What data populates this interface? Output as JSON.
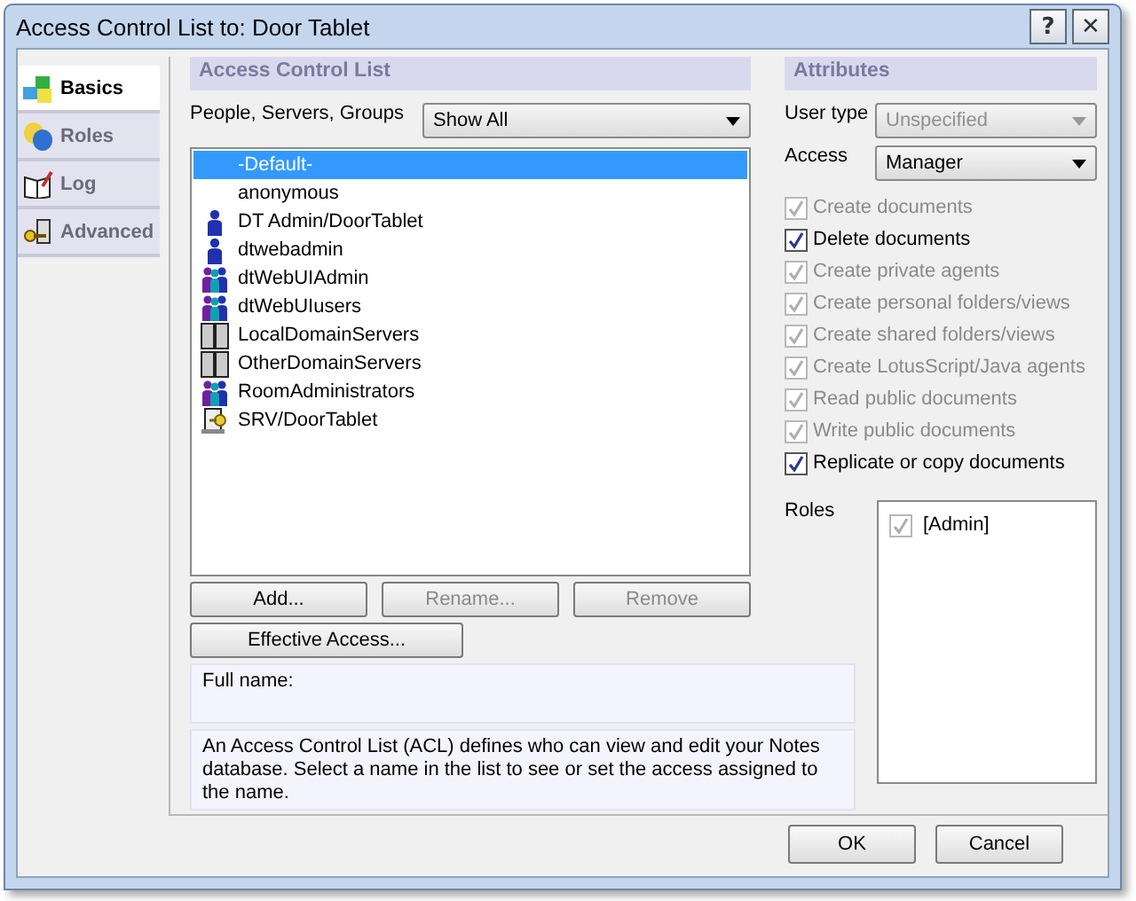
{
  "window": {
    "title": "Access Control List to: Door Tablet",
    "help_button": "?",
    "close_button": "✕"
  },
  "tabs": [
    {
      "label": "Basics",
      "selected": true
    },
    {
      "label": "Roles",
      "selected": false
    },
    {
      "label": "Log",
      "selected": false
    },
    {
      "label": "Advanced",
      "selected": false
    }
  ],
  "acl": {
    "heading": "Access Control List",
    "filter_label": "People, Servers, Groups",
    "filter_value": "Show All",
    "entries": [
      {
        "name": "-Default-",
        "kind": "none",
        "selected": true
      },
      {
        "name": "anonymous",
        "kind": "none",
        "selected": false
      },
      {
        "name": "DT Admin/DoorTablet",
        "kind": "person",
        "selected": false
      },
      {
        "name": "dtwebadmin",
        "kind": "person",
        "selected": false
      },
      {
        "name": "dtWebUIAdmin",
        "kind": "group",
        "selected": false
      },
      {
        "name": "dtWebUIusers",
        "kind": "group",
        "selected": false
      },
      {
        "name": "LocalDomainServers",
        "kind": "servers",
        "selected": false
      },
      {
        "name": "OtherDomainServers",
        "kind": "servers",
        "selected": false
      },
      {
        "name": "RoomAdministrators",
        "kind": "group",
        "selected": false
      },
      {
        "name": "SRV/DoorTablet",
        "kind": "server",
        "selected": false
      }
    ],
    "buttons": [
      {
        "label": "Add...",
        "disabled": false
      },
      {
        "label": "Rename...",
        "disabled": true
      },
      {
        "label": "Remove",
        "disabled": true
      }
    ],
    "effective_access_button": "Effective Access...",
    "full_name_label": "Full name:",
    "description": "An Access Control List (ACL) defines who can view and edit your Notes database.  Select a name in the list to see or set the access assigned to the name."
  },
  "attributes": {
    "heading": "Attributes",
    "user_type": {
      "label": "User type",
      "value": "Unspecified",
      "disabled": true
    },
    "access": {
      "label": "Access",
      "value": "Manager",
      "disabled": false
    },
    "options": [
      {
        "label": "Create documents",
        "checked": true,
        "disabled": true
      },
      {
        "label": "Delete documents",
        "checked": true,
        "disabled": false
      },
      {
        "label": "Create private agents",
        "checked": true,
        "disabled": true
      },
      {
        "label": "Create personal folders/views",
        "checked": true,
        "disabled": true
      },
      {
        "label": "Create shared folders/views",
        "checked": true,
        "disabled": true
      },
      {
        "label": "Create LotusScript/Java agents",
        "checked": true,
        "disabled": true
      },
      {
        "label": "Read public documents",
        "checked": true,
        "disabled": true
      },
      {
        "label": "Write public documents",
        "checked": true,
        "disabled": true
      },
      {
        "label": "Replicate or copy documents",
        "checked": true,
        "disabled": false
      }
    ],
    "roles_label": "Roles",
    "roles": [
      {
        "label": "[Admin]",
        "checked": true
      }
    ]
  },
  "footer_buttons": [
    "OK",
    "Cancel"
  ]
}
